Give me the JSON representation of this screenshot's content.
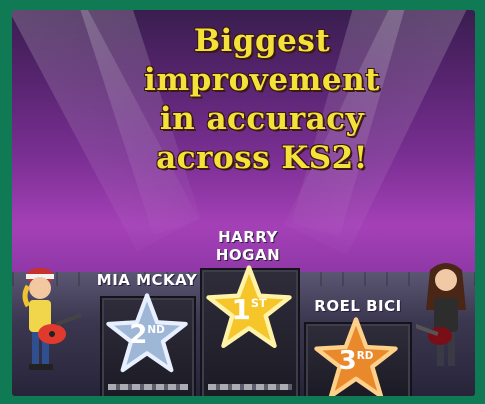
{
  "headline": {
    "line1": "Biggest",
    "line2": "improvement",
    "line3": "in accuracy",
    "line4": "across KS2!"
  },
  "podium": {
    "first": {
      "name_line1": "HARRY",
      "name_line2": "HOGAN",
      "rank_number": "1",
      "rank_suffix": "ST",
      "star_color": "#f6c52a"
    },
    "second": {
      "name": "MIA MCKAY",
      "rank_number": "2",
      "rank_suffix": "ND",
      "star_color": "#9fb7d6"
    },
    "third": {
      "name": "ROEL BICI",
      "rank_number": "3",
      "rank_suffix": "RD",
      "star_color": "#e9892c"
    }
  },
  "colors": {
    "frame": "#0f7a54",
    "headline": "#f4e23b",
    "stage_purple": "#a440b7"
  }
}
